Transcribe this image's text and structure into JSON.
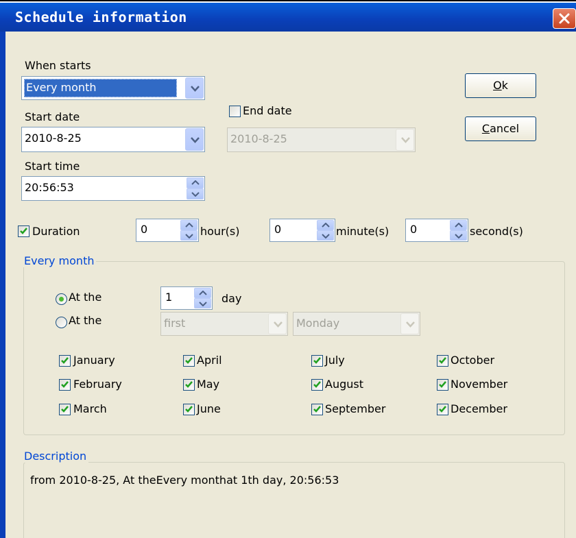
{
  "window": {
    "title": "Schedule information"
  },
  "when_starts": {
    "label": "When starts",
    "value": "Every month"
  },
  "start_date": {
    "label": "Start date",
    "value": "2010-8-25"
  },
  "end_date": {
    "label": "End date",
    "value": "2010-8-25",
    "checked": false
  },
  "start_time": {
    "label": "Start time",
    "value": "20:56:53"
  },
  "buttons": {
    "ok": "Ok",
    "ok_mnemonic": "O",
    "cancel": "Cancel",
    "cancel_mnemonic": "C"
  },
  "duration": {
    "label": "Duration",
    "checked": true,
    "hours": "0",
    "hours_label": "hour(s)",
    "minutes": "0",
    "minutes_label": "minute(s)",
    "seconds": "0",
    "seconds_label": "second(s)"
  },
  "every_month": {
    "legend": "Every month",
    "at_the_day": {
      "label": "At the",
      "value": "1",
      "suffix": "day",
      "selected": true
    },
    "at_the_weekday": {
      "label": "At the",
      "ordinal": "first",
      "weekday": "Monday",
      "selected": false
    },
    "months": [
      "January",
      "April",
      "July",
      "October",
      "February",
      "May",
      "August",
      "November",
      "March",
      "June",
      "September",
      "December"
    ]
  },
  "description": {
    "legend": "Description",
    "text": "from 2010-8-25, At theEvery monthat 1th day, 20:56:53"
  },
  "colors": {
    "title_bar": "#0a3fb8",
    "dialog_bg": "#ece9d8",
    "selection": "#316ac5",
    "group_legend": "#0046d5",
    "check": "#21a121"
  }
}
